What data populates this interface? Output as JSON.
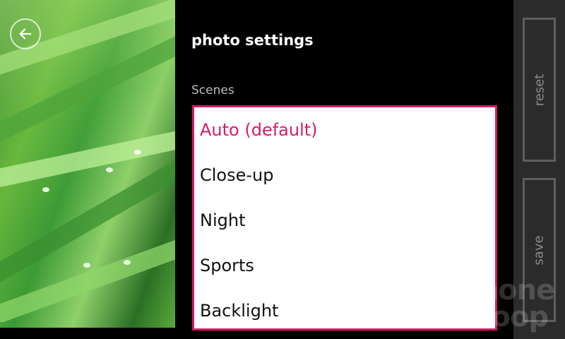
{
  "header": {
    "title": "photo settings"
  },
  "scenes": {
    "label": "Scenes",
    "options": [
      "Auto (default)",
      "Close-up",
      "Night",
      "Sports",
      "Backlight"
    ],
    "selected_index": 0
  },
  "appbar": {
    "reset_label": "reset",
    "save_label": "save"
  },
  "colors": {
    "accent": "#d81b6a",
    "background": "#000000",
    "appbar": "#2b2b2b"
  },
  "icons": {
    "back": "back-arrow-icon"
  }
}
